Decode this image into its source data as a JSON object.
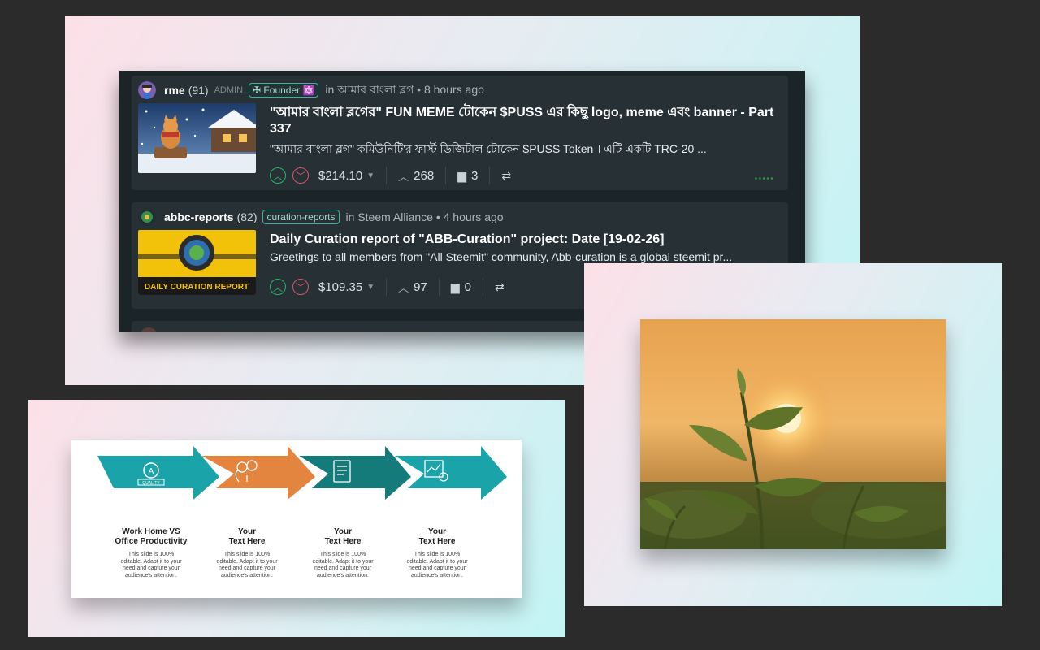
{
  "feed": {
    "posts": [
      {
        "author": "rme",
        "reputation": "(91)",
        "role": "ADMIN",
        "badge": "✠ Founder 🔯",
        "community_text": "in আমার বাংলা ব্লগ • 8 hours ago",
        "title": "\"আমার বাংলা ব্লগের\" FUN MEME টোকেন $PUSS এর কিছু logo, meme এবং banner - Part 337",
        "body": "\"আমার বাংলা ব্লগ\" কমিউনিটি'র ফার্স্ট ডিজিটাল টোকেন $PUSS Token । এটি একটি TRC-20 ...",
        "payout": "$214.10",
        "votes": "268",
        "replies": "3"
      },
      {
        "author": "abbc-reports",
        "reputation": "(82)",
        "badge": "curation-reports",
        "community_text": "in Steem Alliance • 4 hours ago",
        "thumb_text": "DAILY CURATION REPORT",
        "title": "Daily Curation report of \"ABB-Curation\" project: Date [19-02-26]",
        "body": "Greetings to all members from \"All Steemit\" community, Abb-curation is a global steemit pr...",
        "payout": "$109.35",
        "votes": "97",
        "replies": "0"
      }
    ]
  },
  "slide": {
    "arrow_icon_text": "QUALITY",
    "steps": [
      {
        "heading_1": "Work Home VS",
        "heading_2": "Office Productivity",
        "text": [
          "This slide is 100%",
          "editable. Adapt it to your",
          "need and capture your",
          "audience's attention."
        ]
      },
      {
        "heading_1": "Your",
        "heading_2": "Text Here",
        "text": [
          "This slide is 100%",
          "editable. Adapt it to your",
          "need and capture your",
          "audience's attention."
        ]
      },
      {
        "heading_1": "Your",
        "heading_2": "Text Here",
        "text": [
          "This slide is 100%",
          "editable. Adapt it to your",
          "need and capture your",
          "audience's attention."
        ]
      },
      {
        "heading_1": "Your",
        "heading_2": "Text Here",
        "text": [
          "This slide is 100%",
          "editable. Adapt it to your",
          "need and capture your",
          "audience's attention."
        ]
      }
    ],
    "colors": {
      "teal": "#1aa3a9",
      "orange": "#e3843f",
      "dark_teal": "#147a7a"
    }
  },
  "colors": {
    "feed_bg": "#1b2427",
    "post_bg": "#273135",
    "upvote": "#29b36f",
    "downvote": "#d2566b",
    "badge_border": "#39b3a2"
  }
}
